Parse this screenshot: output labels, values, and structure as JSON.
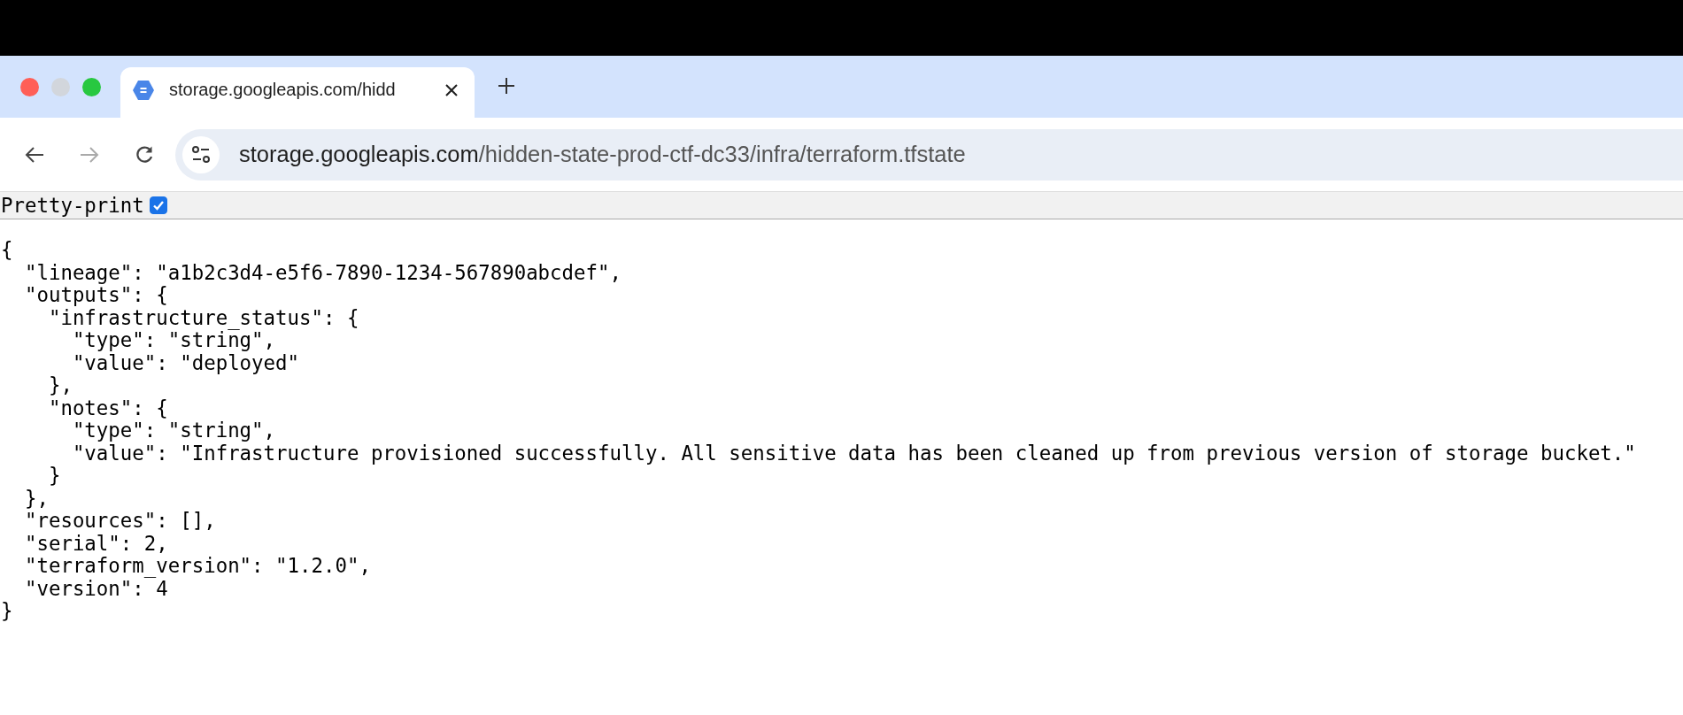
{
  "window": {
    "controls": [
      {
        "kind": "close",
        "disabled": false
      },
      {
        "kind": "minimize",
        "disabled": true
      },
      {
        "kind": "zoom",
        "disabled": false
      }
    ]
  },
  "tabs": [
    {
      "title": "storage.googleapis.com/hidd",
      "selected": true
    }
  ],
  "toolbar": {
    "forward_disabled": true
  },
  "address_bar": {
    "host": "storage.googleapis.com",
    "path": "/hidden-state-prod-ctf-dc33/infra/terraform.tfstate"
  },
  "pretty_print": {
    "label": "Pretty-print",
    "checked": true
  },
  "json_lines": [
    "{",
    "  \"lineage\": \"a1b2c3d4-e5f6-7890-1234-567890abcdef\",",
    "  \"outputs\": {",
    "    \"infrastructure_status\": {",
    "      \"type\": \"string\",",
    "      \"value\": \"deployed\"",
    "    },",
    "    \"notes\": {",
    "      \"type\": \"string\",",
    "      \"value\": \"Infrastructure provisioned successfully. All sensitive data has been cleaned up from previous version of storage bucket.\"",
    "    }",
    "  },",
    "  \"resources\": [],",
    "  \"serial\": 2,",
    "  \"terraform_version\": \"1.2.0\",",
    "  \"version\": 4",
    "}"
  ]
}
